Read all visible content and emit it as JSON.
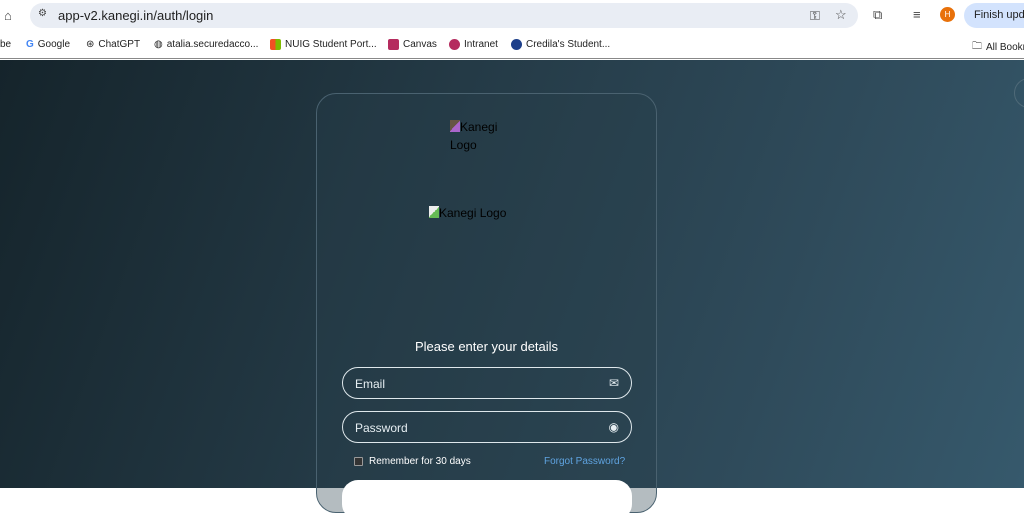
{
  "browser": {
    "url": "app-v2.kanegi.in/auth/login",
    "finish_update": "Finish update",
    "avatar_initial": "H",
    "bookmarks": [
      "be",
      "Google",
      "ChatGPT",
      "atalia.securedacco...",
      "NUIG Student Port...",
      "Canvas",
      "Intranet",
      "Credila's Student..."
    ],
    "all_bookmarks": "All Bookmarks"
  },
  "login": {
    "logo_alt_1": "Kanegi Logo",
    "logo_alt_2": "Kanegi Logo",
    "title": "Please enter your details",
    "email_placeholder": "Email",
    "password_placeholder": "Password",
    "remember": "Remember for 30 days",
    "forgot": "Forgot Password?"
  }
}
